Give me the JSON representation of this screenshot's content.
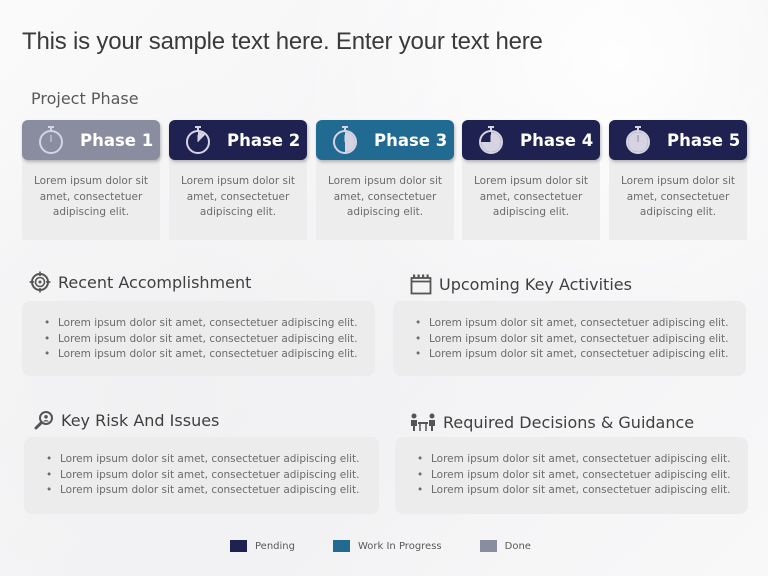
{
  "title": "This is your sample text here. Enter your text here",
  "subtitle": "Project Phase",
  "colors": {
    "pending": "#1f2150",
    "work_in_progress": "#216a91",
    "done": "#8a8c9f"
  },
  "phases": [
    {
      "label": "Phase 1",
      "status": "done",
      "icon": "stopwatch-icon",
      "progress": 0,
      "text": "Lorem ipsum dolor sit amet, consectetuer adipiscing elit."
    },
    {
      "label": "Phase 2",
      "status": "pending",
      "icon": "stopwatch-icon",
      "progress": 0.125,
      "text": "Lorem ipsum dolor sit amet, consectetuer adipiscing elit."
    },
    {
      "label": "Phase 3",
      "status": "work_in_progress",
      "icon": "stopwatch-icon",
      "progress": 0.5,
      "text": "Lorem ipsum dolor sit amet, consectetuer adipiscing elit."
    },
    {
      "label": "Phase 4",
      "status": "pending",
      "icon": "stopwatch-icon",
      "progress": 0.75,
      "text": "Lorem ipsum dolor sit amet, consectetuer adipiscing elit."
    },
    {
      "label": "Phase 5",
      "status": "pending",
      "icon": "stopwatch-icon",
      "progress": 1,
      "text": "Lorem ipsum dolor sit amet, consectetuer adipiscing elit."
    }
  ],
  "sections": [
    {
      "title": "Recent Accomplishment",
      "icon": "target-icon",
      "items": [
        "Lorem ipsum dolor sit amet, consectetuer adipiscing elit.",
        "Lorem ipsum dolor sit amet, consectetuer adipiscing elit.",
        "Lorem ipsum dolor sit amet, consectetuer adipiscing elit."
      ]
    },
    {
      "title": "Upcoming Key Activities",
      "icon": "calendar-icon",
      "items": [
        "Lorem ipsum dolor sit amet, consectetuer adipiscing elit.",
        "Lorem ipsum dolor sit amet, consectetuer adipiscing elit.",
        "Lorem ipsum dolor sit amet, consectetuer adipiscing elit."
      ]
    },
    {
      "title": "Key Risk And Issues",
      "icon": "magnifier-icon",
      "items": [
        "Lorem ipsum dolor sit amet, consectetuer adipiscing elit.",
        "Lorem ipsum dolor sit amet, consectetuer adipiscing elit.",
        "Lorem ipsum dolor sit amet, consectetuer adipiscing elit."
      ]
    },
    {
      "title": "Required Decisions & Guidance",
      "icon": "meeting-icon",
      "items": [
        "Lorem ipsum dolor sit amet, consectetuer adipiscing elit.",
        "Lorem ipsum dolor sit amet, consectetuer adipiscing elit.",
        "Lorem ipsum dolor sit amet, consectetuer adipiscing elit."
      ]
    }
  ],
  "legend": [
    {
      "label": "Pending",
      "status": "pending"
    },
    {
      "label": "Work In Progress",
      "status": "work_in_progress"
    },
    {
      "label": "Done",
      "status": "done"
    }
  ]
}
